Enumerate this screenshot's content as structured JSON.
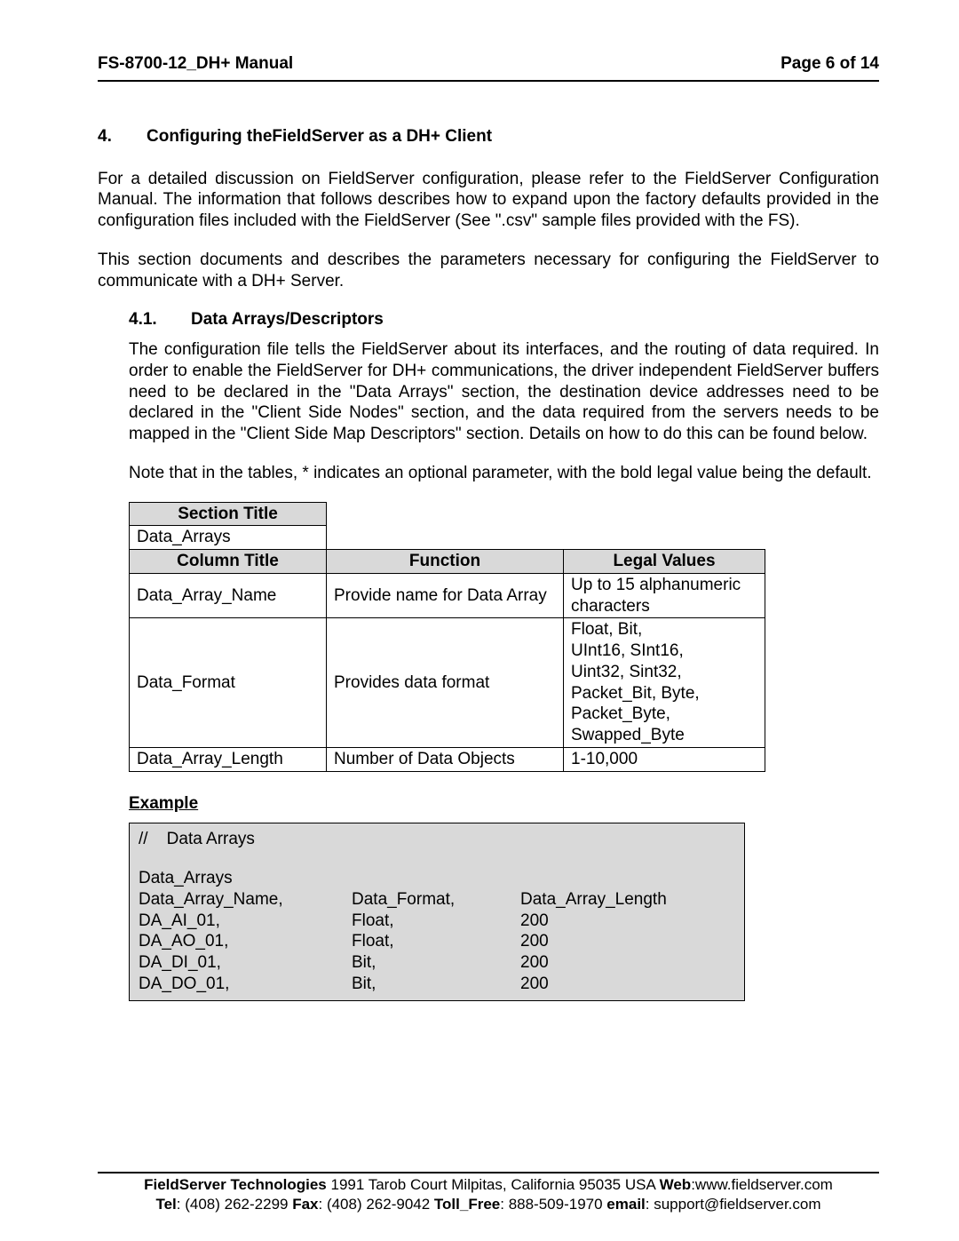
{
  "header": {
    "left": "FS-8700-12_DH+ Manual",
    "right": "Page 6 of 14"
  },
  "section": {
    "num": "4.",
    "title": "Configuring theFieldServer as a DH+ Client",
    "para1": "For a detailed discussion on FieldServer configuration, please refer to the FieldServer Configuration Manual. The information that follows describes how to expand upon the factory defaults provided in the configuration files included with the FieldServer (See \".csv\" sample files provided with the FS).",
    "para2": "This section documents and describes the parameters necessary for configuring the FieldServer to communicate with a DH+ Server."
  },
  "sub": {
    "num": "4.1.",
    "title": "Data Arrays/Descriptors",
    "para1": "The configuration file tells the FieldServer about its interfaces, and the routing of data required. In order to enable the FieldServer for DH+ communications, the driver independent FieldServer buffers need to be declared in the \"Data Arrays\" section, the destination device addresses need to be declared in the \"Client Side Nodes\" section, and the data required from the servers needs to be mapped in the \"Client Side Map Descriptors\" section.  Details on how to do this can be found below.",
    "para2": "Note that in the tables, * indicates an optional parameter, with the bold legal value being the default."
  },
  "table": {
    "sectionTitleHdr": "Section Title",
    "sectionTitleVal": "Data_Arrays",
    "colHdr1": "Column Title",
    "colHdr2": "Function",
    "colHdr3": "Legal Values",
    "rows": [
      {
        "c1": "Data_Array_Name",
        "c2": "Provide name for Data Array",
        "c3": "Up to 15 alphanumeric characters"
      },
      {
        "c1": "Data_Format",
        "c2": "Provides data format",
        "c3": "Float, Bit,\nUInt16, SInt16,\nUint32, Sint32,\nPacket_Bit, Byte,\nPacket_Byte,\nSwapped_Byte"
      },
      {
        "c1": "Data_Array_Length",
        "c2": "Number of Data Objects",
        "c3": "1-10,000"
      }
    ]
  },
  "example": {
    "label": "Example",
    "comment": "//    Data Arrays",
    "header": "Data_Arrays",
    "cols": [
      "Data_Array_Name,",
      "Data_Format,",
      "Data_Array_Length"
    ],
    "rows": [
      [
        "DA_AI_01,",
        "Float,",
        "200"
      ],
      [
        "DA_AO_01,",
        "Float,",
        "200"
      ],
      [
        "DA_DI_01,",
        "Bit,",
        "200"
      ],
      [
        "DA_DO_01,",
        "Bit,",
        "200"
      ]
    ]
  },
  "footer": {
    "line1": {
      "boldCompany": "FieldServer Technologies",
      "addr": " 1991 Tarob Court Milpitas, California 95035 USA  ",
      "webLbl": "Web",
      "web": ":www.fieldserver.com"
    },
    "line2": {
      "telLbl": "Tel",
      "tel": ": (408) 262-2299   ",
      "faxLbl": "Fax",
      "fax": ": (408) 262-9042   ",
      "tollLbl": "Toll_Free",
      "toll": ": 888-509-1970   ",
      "emailLbl": "email",
      "email": ": support@fieldserver.com"
    }
  }
}
